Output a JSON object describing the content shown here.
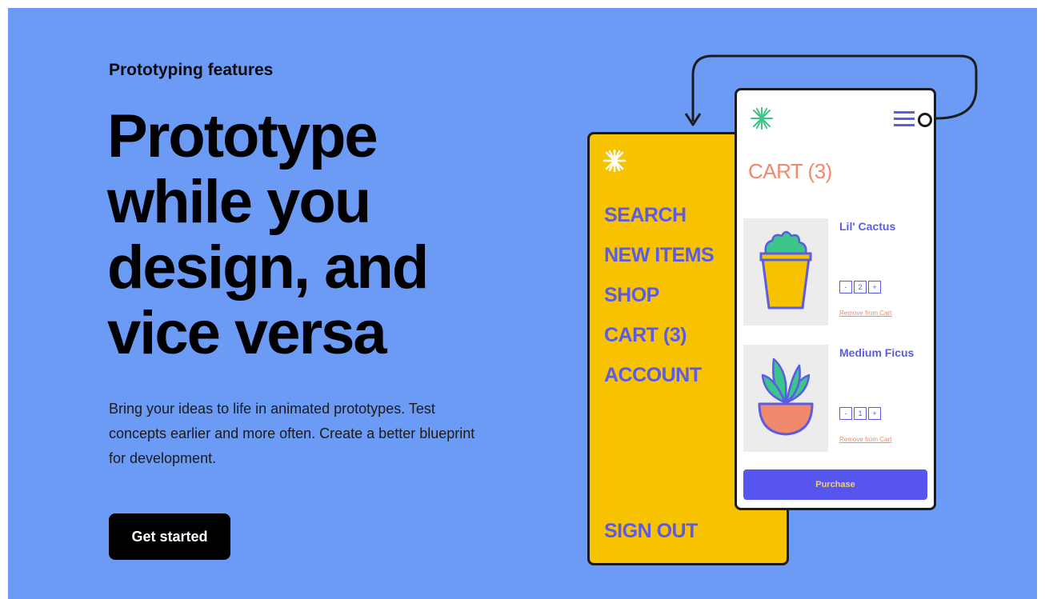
{
  "hero": {
    "eyebrow": "Prototyping features",
    "headline_lines": [
      "Prototype",
      "while you",
      "design, and",
      "vice versa"
    ],
    "description": "Bring your ideas to life in animated prototypes. Test concepts earlier and more often. Create a better blueprint for development.",
    "cta_label": "Get started"
  },
  "menu_screen": {
    "items": [
      "SEARCH",
      "NEW ITEMS",
      "SHOP",
      "CART (3)",
      "ACCOUNT"
    ],
    "sign_out": "SIGN OUT"
  },
  "cart_screen": {
    "title": "CART (3)",
    "products": [
      {
        "name": "Lil' Cactus",
        "quantity": "2",
        "remove_label": "Remove from Cart"
      },
      {
        "name": "Medium Ficus",
        "quantity": "1",
        "remove_label": "Remove from Cart"
      }
    ],
    "stepper": {
      "minus": "-",
      "plus": "+"
    },
    "purchase_label": "Purchase"
  },
  "colors": {
    "background": "#6b9bf5",
    "menu_screen": "#f7c200",
    "accent_purple": "#5b5be6",
    "accent_coral": "#f08a6d",
    "cta": "#000000"
  },
  "icons": [
    "spark-icon",
    "hamburger-icon",
    "cactus-illustration",
    "ficus-illustration",
    "flow-arrow-icon"
  ]
}
